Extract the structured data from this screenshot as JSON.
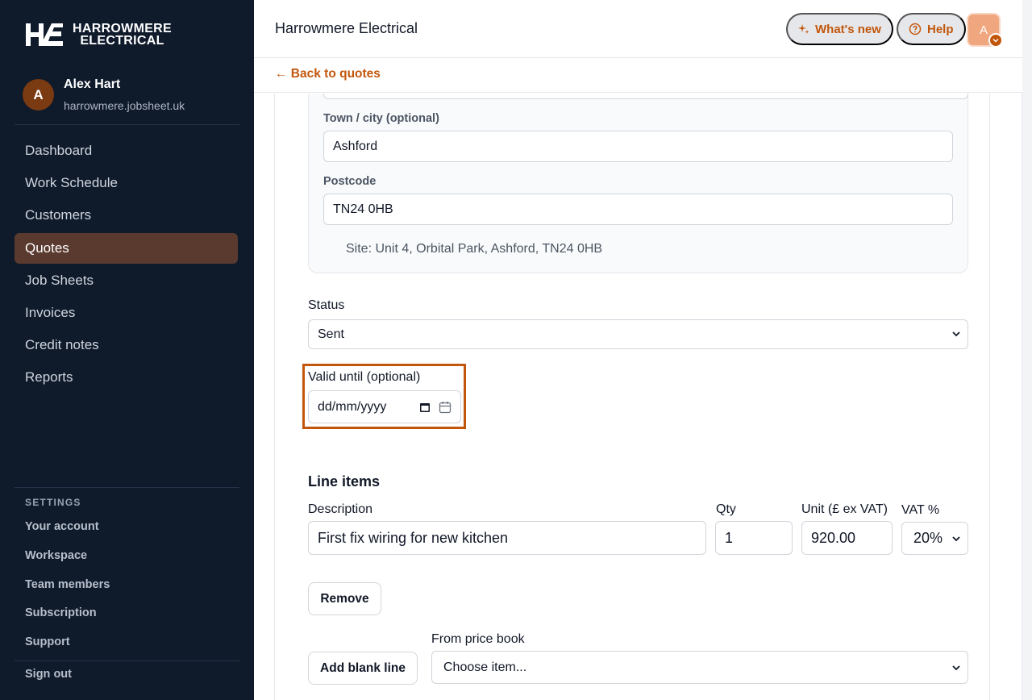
{
  "brand": {
    "line1": "HARROWMERE",
    "line2": "ELECTRICAL",
    "accent": "#c2570c",
    "sidebar_bg": "#0f1a2b"
  },
  "user": {
    "initial": "A",
    "name": "Alex Hart",
    "domain": "harrowmere.jobsheet.uk"
  },
  "nav": {
    "items": [
      "Dashboard",
      "Work Schedule",
      "Customers",
      "Quotes",
      "Job Sheets",
      "Invoices",
      "Credit notes",
      "Reports"
    ],
    "active": "Quotes"
  },
  "settings": {
    "label": "SETTINGS",
    "items": [
      "Your account",
      "Workspace",
      "Team members",
      "Subscription",
      "Support"
    ],
    "signout": "Sign out"
  },
  "header": {
    "company": "Harrowmere Electrical",
    "whats_new": "What's new",
    "help": "Help",
    "avatar_initial": "A"
  },
  "back_link": "← Back to quotes",
  "address": {
    "town_label": "Town / city (optional)",
    "town_value": "Ashford",
    "postcode_label": "Postcode",
    "postcode_value": "TN24 0HB",
    "site_line": "Site: Unit 4, Orbital Park, Ashford, TN24 0HB"
  },
  "status": {
    "label": "Status",
    "value": "Sent"
  },
  "valid_until": {
    "label": "Valid until (optional)",
    "placeholder": "dd/mm/yyyy"
  },
  "line_items": {
    "title": "Line items",
    "headers": {
      "description": "Description",
      "qty": "Qty",
      "unit": "Unit (£ ex VAT)",
      "vat": "VAT %"
    },
    "rows": [
      {
        "description": "First fix wiring for new kitchen",
        "qty": "1",
        "unit": "920.00",
        "vat": "20%"
      }
    ],
    "remove_label": "Remove",
    "add_blank_label": "Add blank line",
    "price_book_label": "From price book",
    "price_book_placeholder": "Choose item..."
  }
}
